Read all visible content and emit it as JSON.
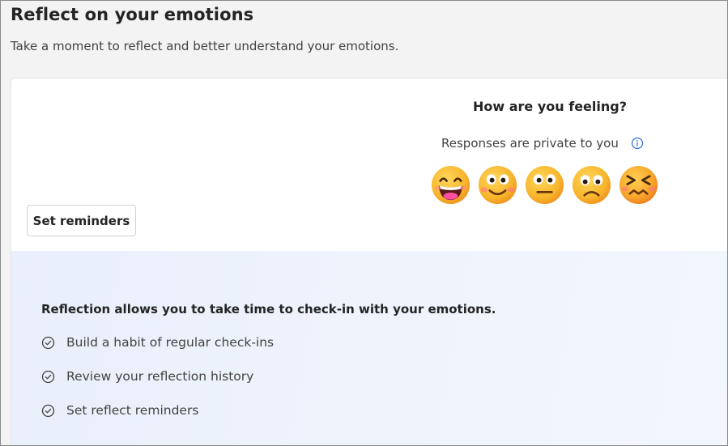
{
  "header": {
    "title": "Reflect on your emotions",
    "subtitle": "Take a moment to reflect and better understand your emotions."
  },
  "card": {
    "reminder_button": "Set reminders",
    "question": "How are you feeling?",
    "privacy_note": "Responses are private to you",
    "info_icon": "info-icon",
    "emojis": [
      "grinning-face-icon",
      "smiling-face-icon",
      "neutral-face-icon",
      "frowning-face-icon",
      "confounded-face-icon"
    ]
  },
  "info": {
    "intro": "Reflection allows you to take time to check-in with your emotions.",
    "benefits": [
      "Build a habit of regular check-ins",
      "Review your reflection history",
      "Set reflect reminders"
    ],
    "benefit_icon": "check-circle-icon"
  },
  "colors": {
    "background": "#f3f3f3",
    "card": "#ffffff",
    "info_panel": "#eaf0fb",
    "info_icon": "#2b6fd6",
    "emoji_yellow": "#f9b233"
  }
}
